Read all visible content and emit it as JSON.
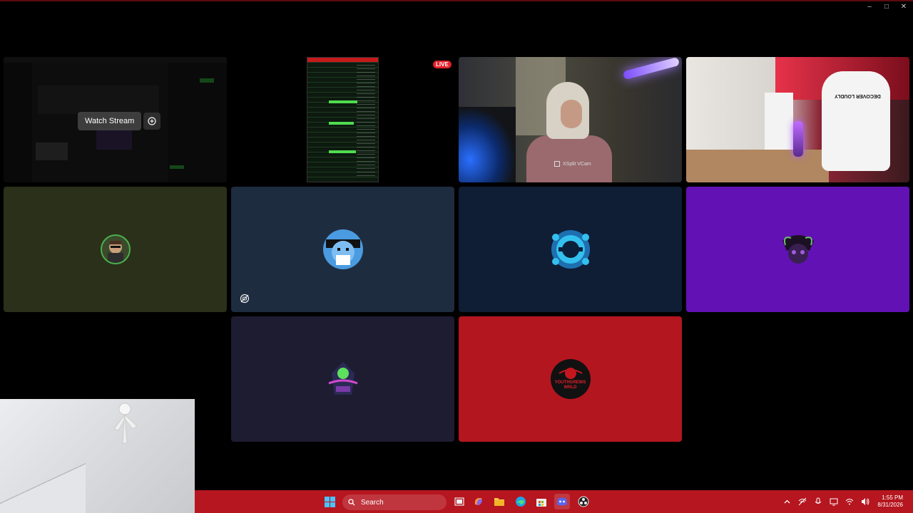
{
  "window": {
    "controls": {
      "minimize": "–",
      "maximize": "□",
      "close": "✕"
    }
  },
  "tiles": {
    "stream": {
      "watch_label": "Watch Stream"
    },
    "screen": {
      "live_label": "LIVE"
    },
    "cam1": {
      "camera_label": "XSplit VCam"
    },
    "cam2": {
      "chair_text": "DECOVER LOUDLY"
    },
    "avatars": [
      {
        "tile": "avatar-1",
        "bg": "#2a3019",
        "color": "#4caf50"
      },
      {
        "tile": "avatar-2",
        "bg": "#1e2c40",
        "color": "#5aa3e6",
        "muted": true
      },
      {
        "tile": "avatar-3",
        "bg": "#0f1d35",
        "color": "#38b6e8"
      },
      {
        "tile": "avatar-4",
        "bg": "#6212b4",
        "color": "#2a1638"
      },
      {
        "tile": "avatar-5",
        "bg": "#1d1c31",
        "color": "#3b2a66"
      },
      {
        "tile": "avatar-6",
        "bg": "#b4161f",
        "color": "#111111",
        "text": "YOUTHGREWS WRLD"
      }
    ]
  },
  "taskbar": {
    "search_placeholder": "Search",
    "clock_time": "1:55 PM",
    "clock_date": "8/31/2026",
    "accent": "#b5161f"
  },
  "colors": {
    "live": "#e0212b",
    "background": "#000000"
  }
}
